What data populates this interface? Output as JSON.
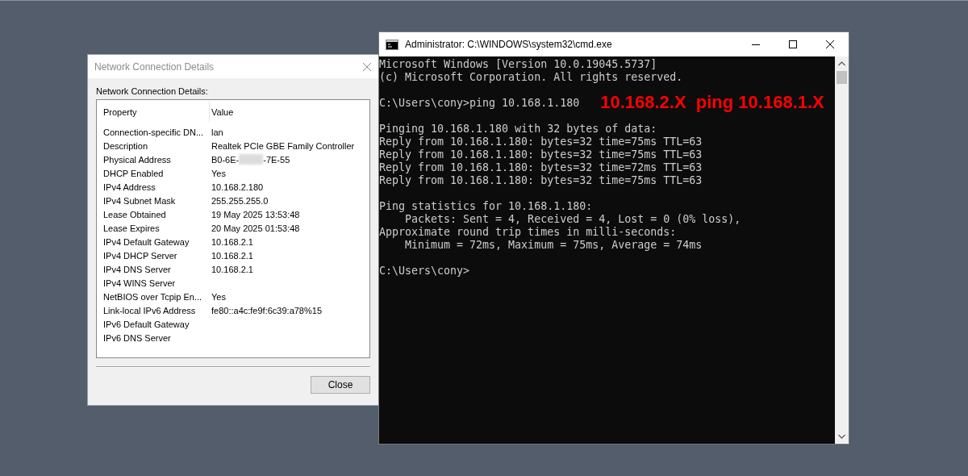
{
  "dialog": {
    "title": "Network Connection Details",
    "active": false,
    "label": "Network Connection Details:",
    "columns": [
      "Property",
      "Value"
    ],
    "rows": [
      {
        "property": "Connection-specific DN...",
        "value": "lan"
      },
      {
        "property": "Description",
        "value": "Realtek PCIe GBE Family Controller"
      },
      {
        "property": "Physical Address",
        "value": "B0-6E-",
        "redacted": true,
        "value_end": "-7E-55"
      },
      {
        "property": "DHCP Enabled",
        "value": "Yes"
      },
      {
        "property": "IPv4 Address",
        "value": "10.168.2.180"
      },
      {
        "property": "IPv4 Subnet Mask",
        "value": "255.255.255.0"
      },
      {
        "property": "Lease Obtained",
        "value": "19 May 2025 13:53:48"
      },
      {
        "property": "Lease Expires",
        "value": "20 May 2025 01:53:48"
      },
      {
        "property": "IPv4 Default Gateway",
        "value": "10.168.2.1"
      },
      {
        "property": "IPv4 DHCP Server",
        "value": "10.168.2.1"
      },
      {
        "property": "IPv4 DNS Server",
        "value": "10.168.2.1"
      },
      {
        "property": "IPv4 WINS Server"
      },
      {
        "property": "NetBIOS over Tcpip En...",
        "value": "Yes"
      },
      {
        "property": "Link-local IPv6 Address",
        "value": "fe80::a4c:fe9f:6c39:a78%15"
      },
      {
        "property": "IPv6 Default Gateway"
      },
      {
        "property": "IPv6 DNS Server"
      }
    ],
    "button": "Close"
  },
  "console": {
    "title": "Administrator: C:\\WINDOWS\\system32\\cmd.exe",
    "active": true,
    "blocks": [
      [
        {
          "text": "Microsoft Windows [Version 10.0.19045.5737]"
        },
        {
          "text": "(c) Microsoft Corporation. All rights reserved."
        }
      ],
      [
        {
          "text": "C:\\Users\\cony>ping 10.168.1.180",
          "annotation": "10.168.2.X  ping 10.168.1.X"
        }
      ],
      [
        {
          "text": "Pinging 10.168.1.180 with 32 bytes of data:"
        },
        {
          "text": "Reply from 10.168.1.180: bytes=32 time=75ms TTL=63"
        },
        {
          "text": "Reply from 10.168.1.180: bytes=32 time=75ms TTL=63"
        },
        {
          "text": "Reply from 10.168.1.180: bytes=32 time=72ms TTL=63"
        },
        {
          "text": "Reply from 10.168.1.180: bytes=32 time=75ms TTL=63"
        }
      ],
      [
        {
          "text": "Ping statistics for 10.168.1.180:"
        },
        {
          "text": "    Packets: Sent = 4, Received = 4, Lost = 0 (0% loss),"
        },
        {
          "text": "Approximate round trip times in milli-seconds:"
        },
        {
          "text": "    Minimum = 72ms, Maximum = 75ms, Average = 74ms"
        }
      ],
      [
        {
          "text": "C:\\Users\\cony>"
        }
      ]
    ]
  }
}
